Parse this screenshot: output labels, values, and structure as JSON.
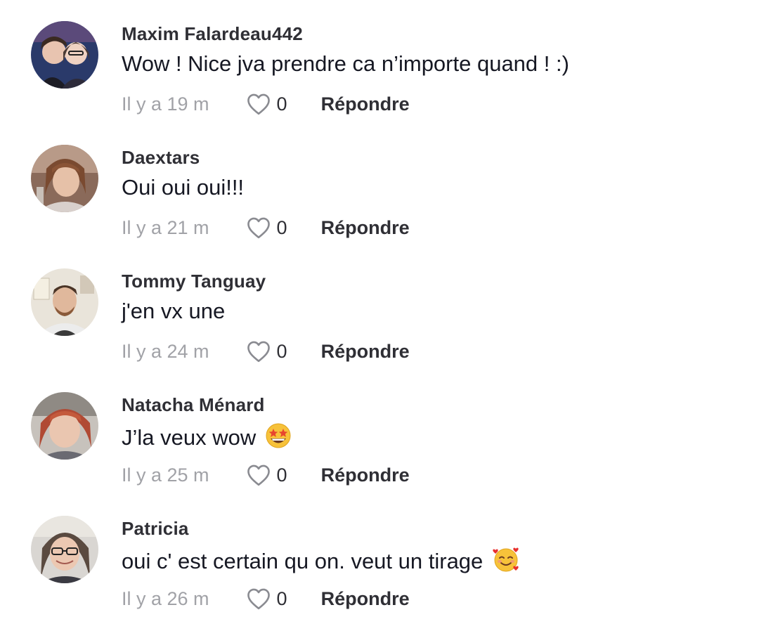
{
  "comments": [
    {
      "username": "Maxim Falardeau442",
      "text": "Wow ! Nice jva prendre ca n’importe quand ! :)",
      "time": "Il y a 19 m",
      "likes": "0",
      "reply_label": "Répondre"
    },
    {
      "username": "Daextars",
      "text": "Oui oui oui!!!",
      "time": "Il y a 21 m",
      "likes": "0",
      "reply_label": "Répondre"
    },
    {
      "username": "Tommy Tanguay",
      "text": "j'en vx une",
      "time": "Il y a 24 m",
      "likes": "0",
      "reply_label": "Répondre"
    },
    {
      "username": "Natacha Ménard",
      "text": "J’la veux wow",
      "emoji": "star-struck-emoji",
      "time": "Il y a 25 m",
      "likes": "0",
      "reply_label": "Répondre"
    },
    {
      "username": "Patricia",
      "text": "oui c' est certain qu on. veut un tirage",
      "emoji": "smiling-face-with-hearts-emoji",
      "time": "Il y a 26 m",
      "likes": "0",
      "reply_label": "Répondre"
    }
  ],
  "icons": {
    "like": "heart-outline-icon"
  },
  "colors": {
    "username": "#2f2f35",
    "text": "#161823",
    "timestamp": "#a1a2a7"
  }
}
